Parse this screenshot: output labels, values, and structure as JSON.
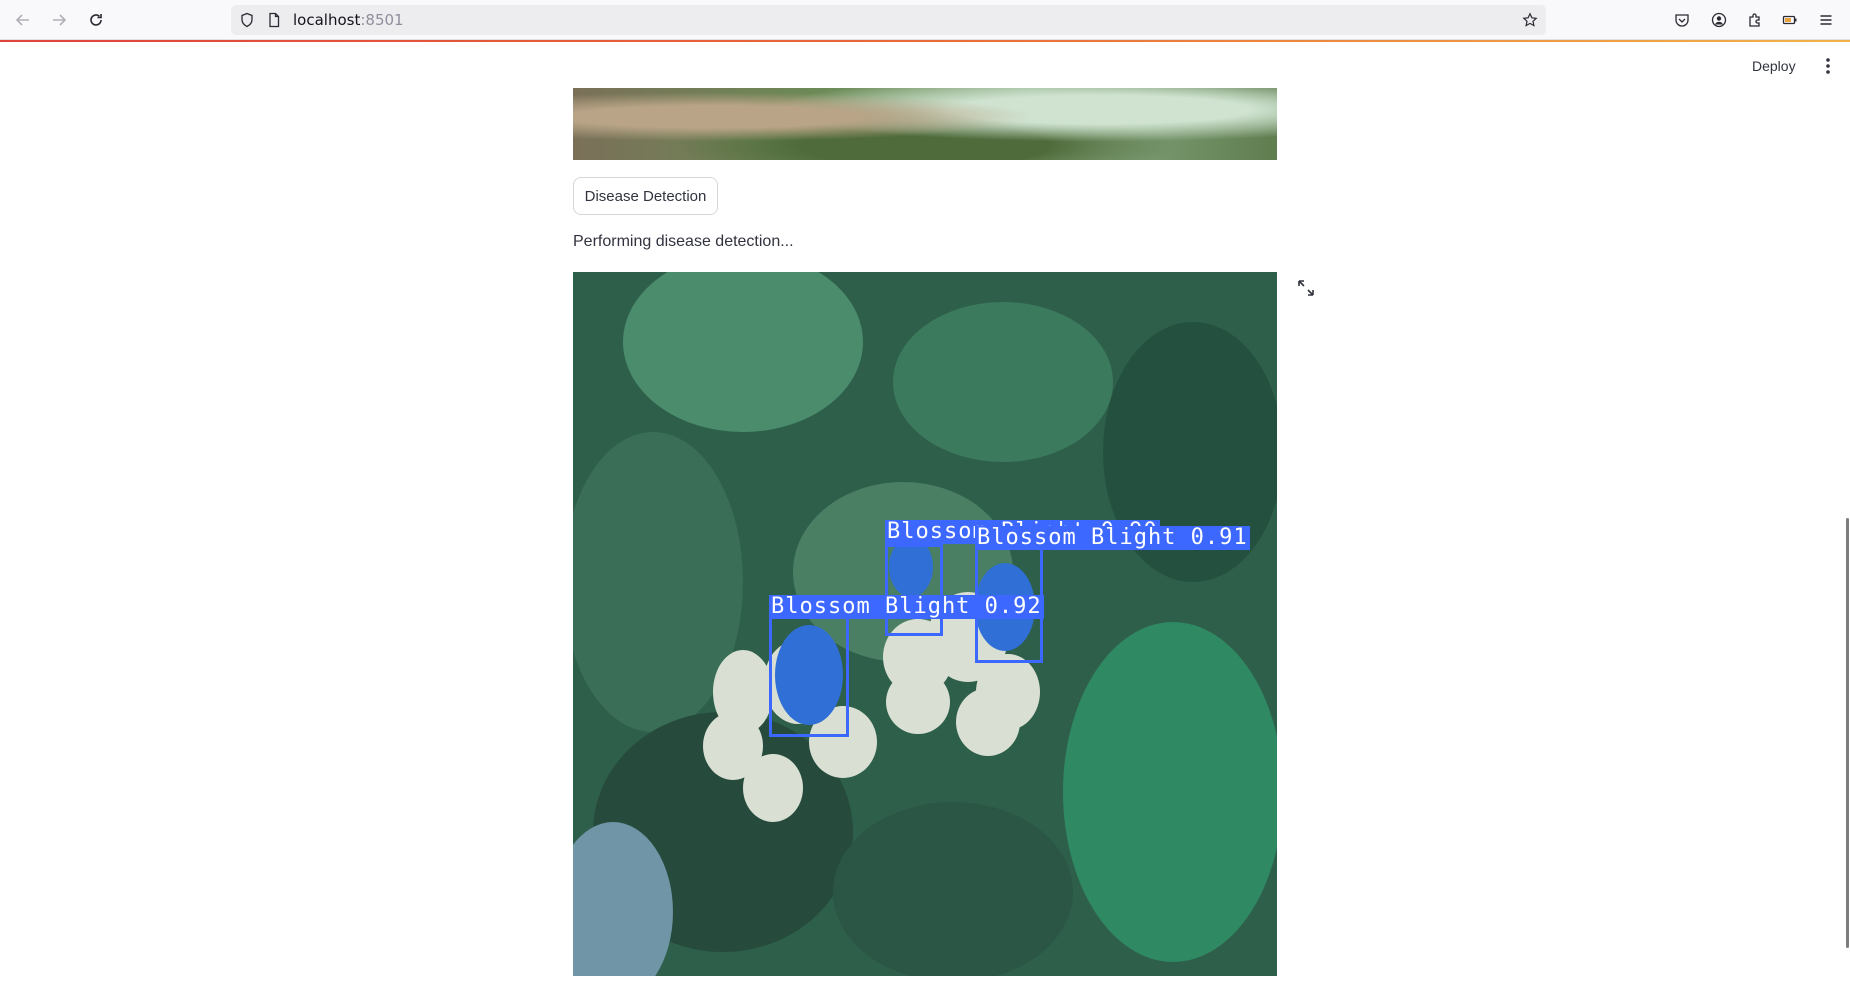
{
  "browser": {
    "url_host": "localhost",
    "url_port": ":8501",
    "icons": [
      "back-arrow-icon",
      "forward-arrow-icon",
      "reload-icon",
      "shield-icon",
      "page-icon",
      "star-icon",
      "pocket-icon",
      "account-icon",
      "extensions-icon",
      "battery-icon",
      "menu-icon"
    ]
  },
  "header": {
    "deploy_label": "Deploy",
    "menu_icon": "vertical-dots-icon"
  },
  "main": {
    "detect_button_label": "Disease Detection",
    "status_text": "Performing disease detection...",
    "fullscreen_icon": "expand-icon",
    "detections": [
      {
        "label": "Blossom Blight 0.92"
      },
      {
        "label": "Blossom Blight 0.91"
      },
      {
        "label": "Blossom Blight 0.90"
      }
    ]
  },
  "colors": {
    "accent_gradient": [
      "#e0433b",
      "#f0b24a"
    ],
    "detection_box": "#3c68ff"
  }
}
